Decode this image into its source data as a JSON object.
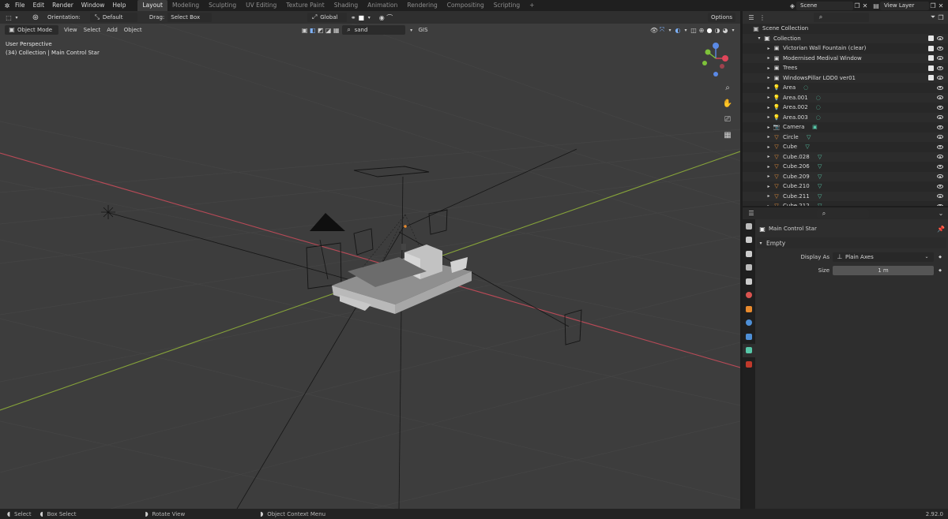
{
  "topbar": {
    "menus": [
      "File",
      "Edit",
      "Render",
      "Window",
      "Help"
    ],
    "workspaces": [
      "Layout",
      "Modeling",
      "Sculpting",
      "UV Editing",
      "Texture Paint",
      "Shading",
      "Animation",
      "Rendering",
      "Compositing",
      "Scripting"
    ],
    "active_workspace": "Layout",
    "add_tab": "+",
    "scene": "Scene",
    "view_layer": "View Layer"
  },
  "viewport_header": {
    "orientation_label": "Orientation:",
    "orientation_value": "Default",
    "drag_label": "Drag:",
    "drag_value": "Select Box",
    "transform_space": "Global",
    "options": "Options"
  },
  "viewport_header2": {
    "mode": "Object Mode",
    "menus": [
      "View",
      "Select",
      "Add",
      "Object"
    ],
    "search_value": "sand",
    "gis": "GIS"
  },
  "viewport_info": {
    "perspective": "User Perspective",
    "collection": "(34) Collection | Main Control Star"
  },
  "outliner": {
    "scene_collection": "Scene Collection",
    "collection": "Collection",
    "items": [
      {
        "name": "Victorian Wall Fountain (clear)",
        "type": "collection",
        "checked": true
      },
      {
        "name": "Modernised Medival Window",
        "type": "collection",
        "checked": true
      },
      {
        "name": "Trees",
        "type": "collection",
        "checked": true
      },
      {
        "name": "WindowsPillar LOD0 ver01",
        "type": "collection",
        "checked": true
      },
      {
        "name": "Area",
        "type": "light"
      },
      {
        "name": "Area.001",
        "type": "light"
      },
      {
        "name": "Area.002",
        "type": "light"
      },
      {
        "name": "Area.003",
        "type": "light"
      },
      {
        "name": "Camera",
        "type": "camera"
      },
      {
        "name": "Circle",
        "type": "mesh"
      },
      {
        "name": "Cube",
        "type": "mesh"
      },
      {
        "name": "Cube.028",
        "type": "mesh"
      },
      {
        "name": "Cube.206",
        "type": "mesh"
      },
      {
        "name": "Cube.209",
        "type": "mesh"
      },
      {
        "name": "Cube.210",
        "type": "mesh"
      },
      {
        "name": "Cube.211",
        "type": "mesh"
      },
      {
        "name": "Cube.212",
        "type": "mesh"
      }
    ]
  },
  "properties": {
    "object_name": "Main Control Star",
    "panel": "Empty",
    "display_as_label": "Display As",
    "display_as_value": "Plain Axes",
    "size_label": "Size",
    "size_value": "1 m"
  },
  "statusbar": {
    "select": "Select",
    "box_select": "Box Select",
    "rotate_view": "Rotate View",
    "context_menu": "Object Context Menu",
    "version": "2.92.0"
  },
  "colors": {
    "viewport_bg": "#3d3d3d",
    "x_axis": "#b84a57",
    "y_axis": "#86a33a",
    "active_icon": "#e88a2d",
    "mesh_icon": "#e8903b",
    "data_icon": "#57c7a8"
  }
}
